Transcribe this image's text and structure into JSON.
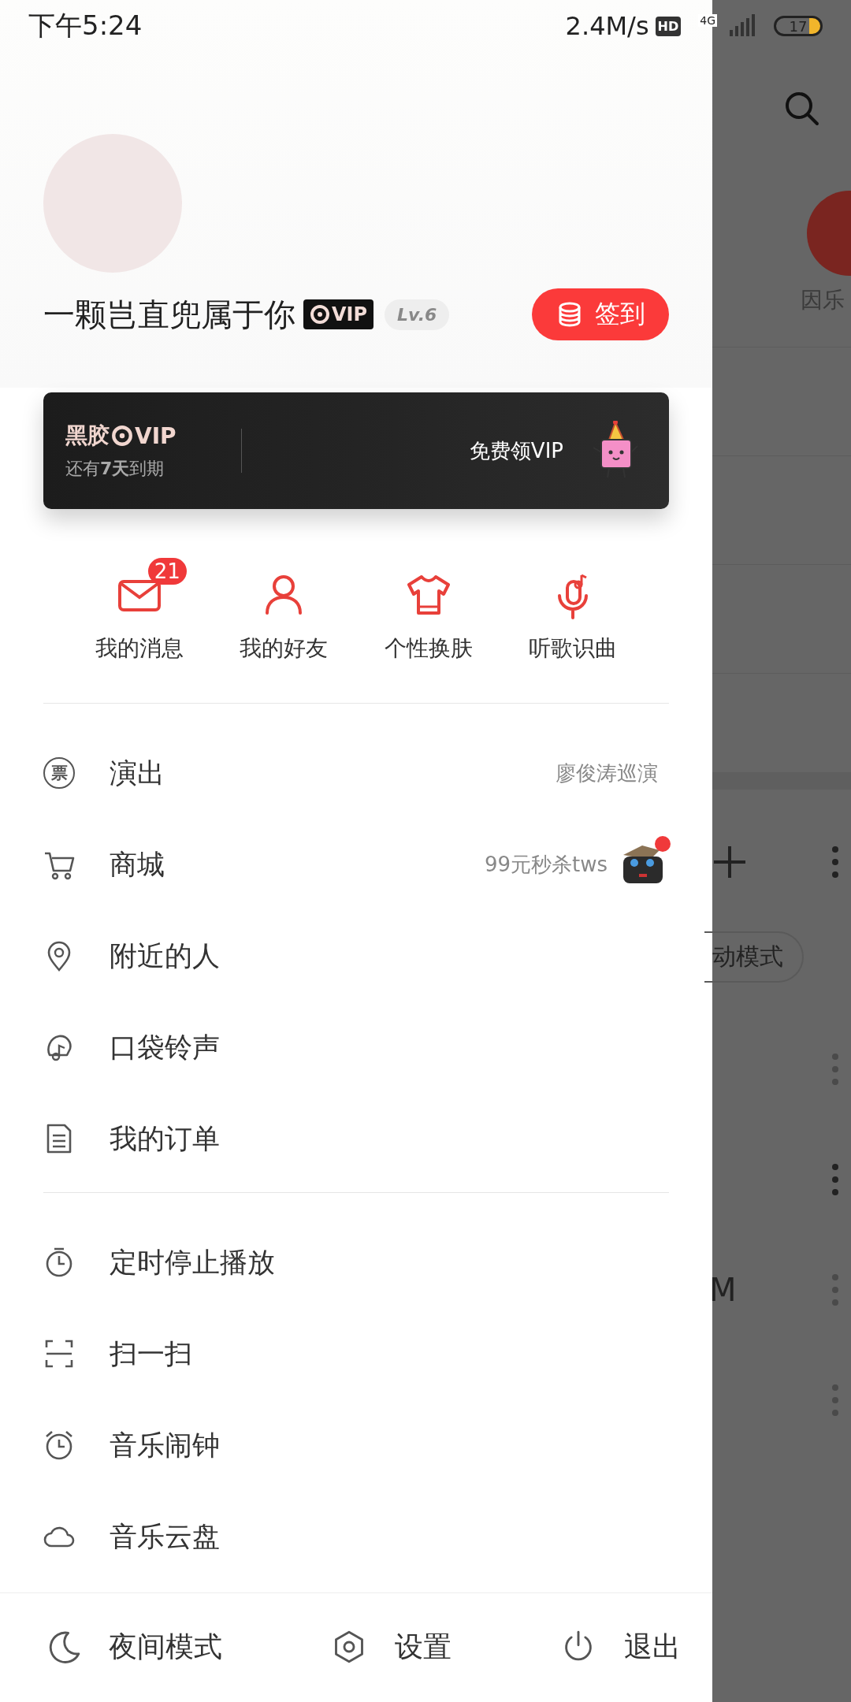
{
  "status_bar": {
    "time": "下午5:24",
    "speed": "2.4M/s",
    "hd": "HD",
    "network": "4G",
    "battery": "17"
  },
  "profile": {
    "name": "一颗岂直兜属于你",
    "vip_badge": "VIP",
    "level": "Lv.6",
    "sign_in_button": "签到"
  },
  "vip_card": {
    "brand": "黑胶",
    "brand_vip": "VIP",
    "expiry": "还有**7天**到期",
    "cta": "免费领VIP"
  },
  "shortcuts": [
    {
      "label": "我的消息",
      "badge": "21"
    },
    {
      "label": "我的好友"
    },
    {
      "label": "个性换肤"
    },
    {
      "label": "听歌识曲"
    }
  ],
  "menu_groups": [
    [
      {
        "label": "演出",
        "kind": "detail",
        "icon_text": "票",
        "detail": "廖俊涛巡演",
        "unread_dot": false
      },
      {
        "label": "商城",
        "kind": "promo",
        "detail": "99元秒杀tws",
        "unread_dot": true
      },
      {
        "label": "附近的人",
        "kind": "plain",
        "unread_dot": false
      },
      {
        "label": "口袋铃声",
        "kind": "plain",
        "unread_dot": false
      },
      {
        "label": "我的订单",
        "kind": "plain",
        "unread_dot": false
      }
    ],
    [
      {
        "label": "定时停止播放",
        "kind": "plain",
        "unread_dot": false
      },
      {
        "label": "扫一扫",
        "kind": "plain",
        "unread_dot": false
      },
      {
        "label": "音乐闹钟",
        "kind": "plain",
        "unread_dot": false
      },
      {
        "label": "音乐云盘",
        "kind": "plain",
        "unread_dot": false
      }
    ]
  ],
  "footer": [
    {
      "label": "夜间模式"
    },
    {
      "label": "设置"
    },
    {
      "label": "退出"
    }
  ],
  "background": {
    "banner_label": "因乐",
    "mode_pill": "动模式",
    "row_text": "M"
  }
}
